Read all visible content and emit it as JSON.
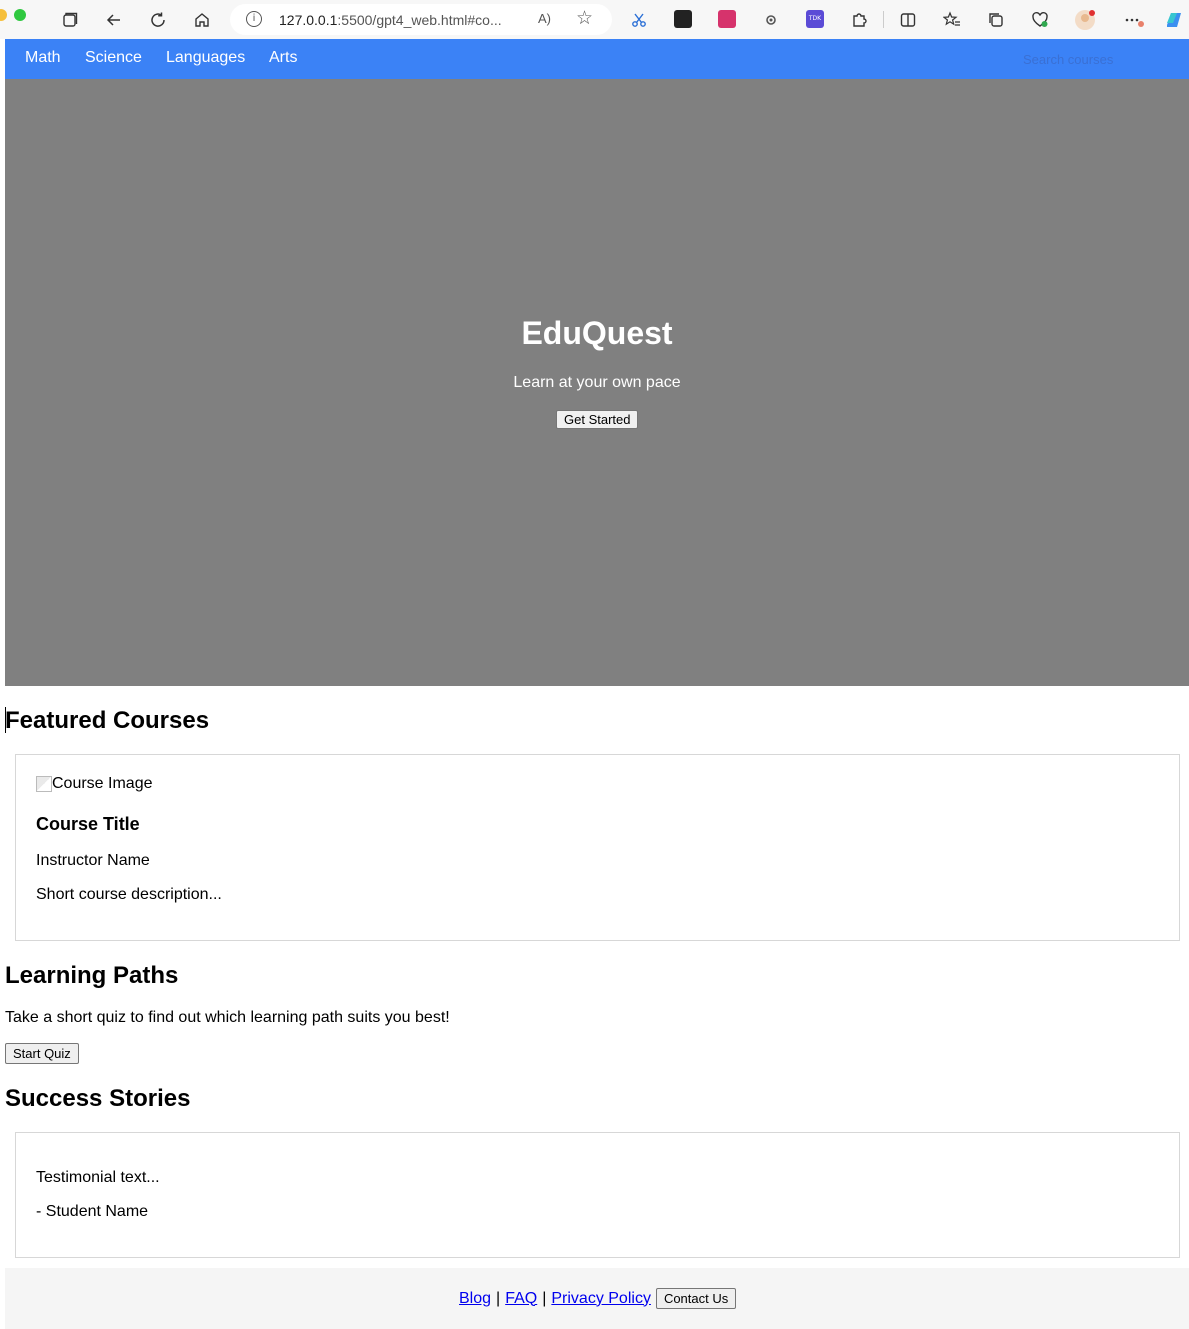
{
  "browser": {
    "url_host": "127.0.0.1",
    "url_path": ":5500/gpt4_web.html#co...",
    "read_aloud": "A)",
    "ext_badge_label": "TDK"
  },
  "nav": {
    "links": [
      "Math",
      "Science",
      "Languages",
      "Arts"
    ],
    "search_placeholder": "Search courses"
  },
  "hero": {
    "title": "EduQuest",
    "tagline": "Learn at your own pace",
    "cta_label": "Get Started"
  },
  "featured": {
    "heading": "Featured Courses",
    "card": {
      "image_alt": "Course Image",
      "title": "Course Title",
      "instructor": "Instructor Name",
      "description": "Short course description..."
    }
  },
  "learning": {
    "heading": "Learning Paths",
    "text": "Take a short quiz to find out which learning path suits you best!",
    "button": "Start Quiz"
  },
  "stories": {
    "heading": "Success Stories",
    "testimonial": "Testimonial text...",
    "author": "- Student Name"
  },
  "footer": {
    "links": [
      "Blog",
      "FAQ",
      "Privacy Policy"
    ],
    "separator": "|",
    "contact_label": "Contact Us"
  },
  "colors": {
    "nav_bg": "#3b82f6",
    "hero_bg": "#808080",
    "footer_bg": "#f5f5f5"
  }
}
